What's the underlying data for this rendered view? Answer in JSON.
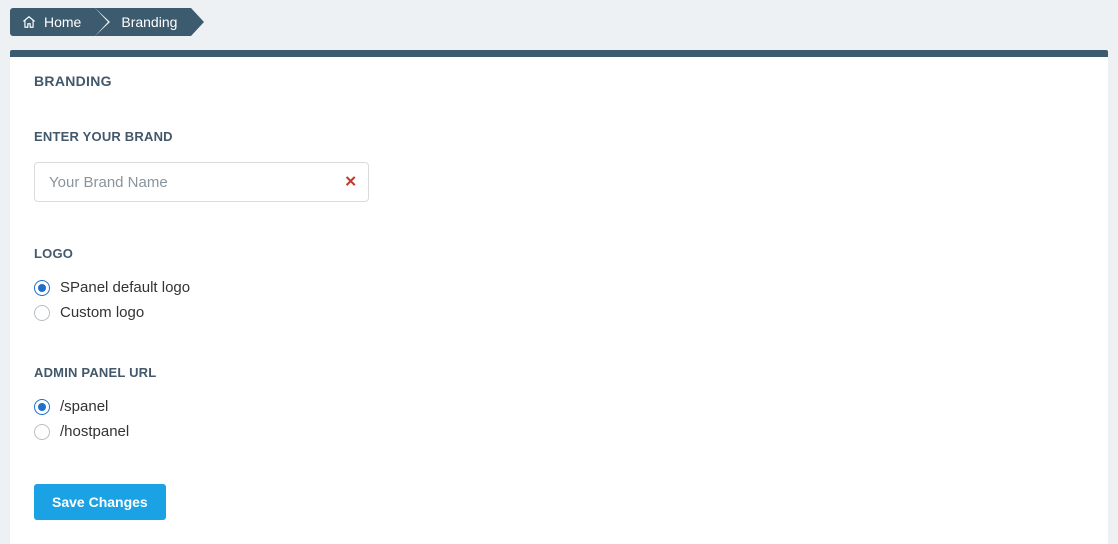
{
  "breadcrumb": {
    "home_label": "Home",
    "current_label": "Branding"
  },
  "panel": {
    "title": "BRANDING",
    "brand_section": {
      "label": "ENTER YOUR BRAND",
      "input_placeholder": "Your Brand Name",
      "input_value": ""
    },
    "logo_section": {
      "label": "LOGO",
      "options": [
        {
          "label": "SPanel default logo",
          "checked": true
        },
        {
          "label": "Custom logo",
          "checked": false
        }
      ]
    },
    "admin_url_section": {
      "label": "ADMIN PANEL URL",
      "options": [
        {
          "label": "/spanel",
          "checked": true
        },
        {
          "label": "/hostpanel",
          "checked": false
        }
      ]
    },
    "save_label": "Save Changes"
  }
}
